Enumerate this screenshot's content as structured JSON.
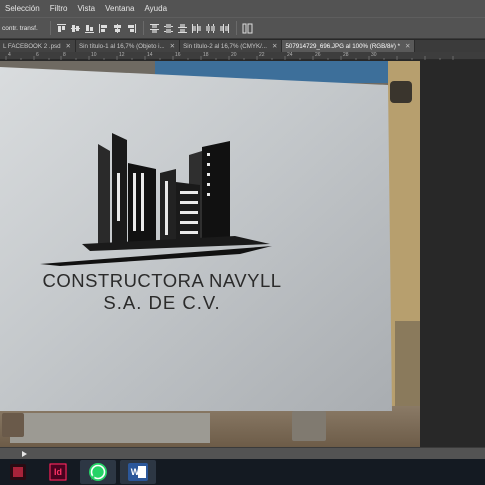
{
  "menu": {
    "items": [
      "Selección",
      "Filtro",
      "Vista",
      "Ventana",
      "Ayuda"
    ]
  },
  "options": {
    "transform_label": "contr. transf."
  },
  "tabs": [
    {
      "label": "L FACEBOOK 2 .psd",
      "active": false
    },
    {
      "label": "Sin título-1 al 16,7% (Objeto i...",
      "active": false
    },
    {
      "label": "Sin título-2 al 16,7% (CMYK/...",
      "active": false
    },
    {
      "label": "507914729_696.JPG al 100% (RGB/8#) *",
      "active": true
    }
  ],
  "ruler": {
    "labels": [
      "4",
      "6",
      "8",
      "10",
      "12",
      "14",
      "16",
      "18",
      "20",
      "22",
      "24",
      "26",
      "28",
      "30"
    ]
  },
  "logo": {
    "line1": "CONSTRUCTORA NAVYLL",
    "line2": "S.A. DE C.V."
  },
  "taskbar": {
    "apps": [
      {
        "name": "adobe-app",
        "label": ""
      },
      {
        "name": "indesign",
        "label": "Id"
      },
      {
        "name": "whatsapp",
        "label": ""
      },
      {
        "name": "word",
        "label": "W"
      }
    ]
  },
  "colors": {
    "panel": "#535353",
    "tab_active": "#595959",
    "pasteboard": "#282828",
    "indesign_pink": "#ff3366",
    "whatsapp_green": "#25d366",
    "word_blue": "#2b579a"
  }
}
